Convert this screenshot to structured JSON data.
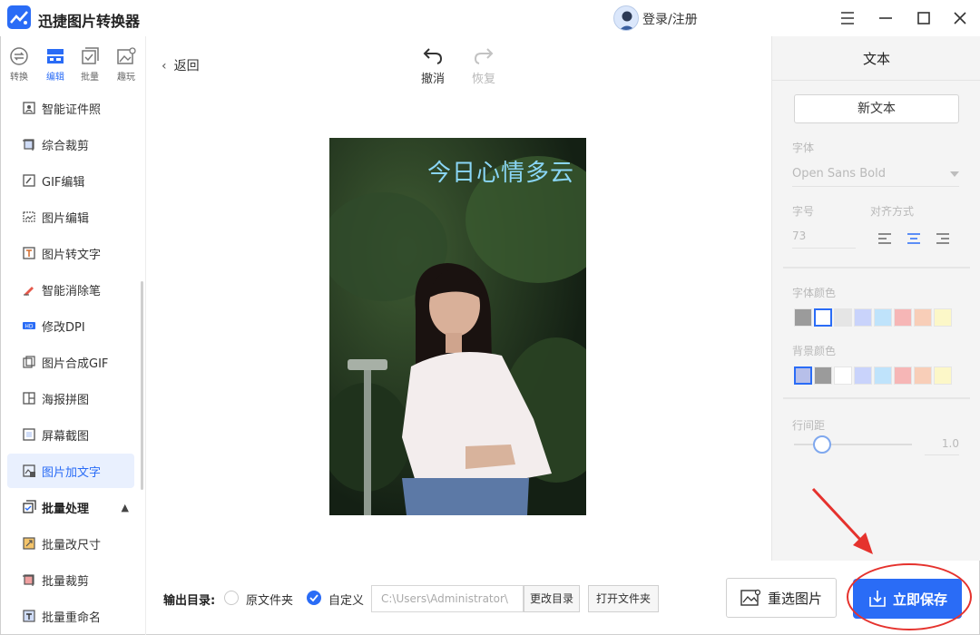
{
  "app": {
    "title": "迅捷图片转换器",
    "login": "登录/注册"
  },
  "tool_tabs": [
    {
      "label": "转换"
    },
    {
      "label": "编辑"
    },
    {
      "label": "批量"
    },
    {
      "label": "趣玩"
    }
  ],
  "sidebar": {
    "items": [
      {
        "label": "智能证件照"
      },
      {
        "label": "综合裁剪"
      },
      {
        "label": "GIF编辑"
      },
      {
        "label": "图片编辑"
      },
      {
        "label": "图片转文字"
      },
      {
        "label": "智能消除笔"
      },
      {
        "label": "修改DPI"
      },
      {
        "label": "图片合成GIF"
      },
      {
        "label": "海报拼图"
      },
      {
        "label": "屏幕截图"
      },
      {
        "label": "图片加文字"
      }
    ],
    "group": {
      "label": "批量处理"
    },
    "group_items": [
      {
        "label": "批量改尺寸"
      },
      {
        "label": "批量裁剪"
      },
      {
        "label": "批量重命名"
      }
    ]
  },
  "center": {
    "back": "返回",
    "undo": "撤消",
    "redo": "恢复",
    "overlay_text": "今日心情多云"
  },
  "panel": {
    "title": "文本",
    "new_text": "新文本",
    "font_label": "字体",
    "font_value": "Open Sans Bold",
    "size_label": "字号",
    "size_value": "73",
    "align_label": "对齐方式",
    "font_color_label": "字体颜色",
    "bg_color_label": "背景颜色",
    "line_spacing_label": "行间距",
    "line_spacing_value": "1.0",
    "font_colors": [
      "#9b9b9b",
      "#ffffff",
      "#e5e5e5",
      "#c9d3fb",
      "#bfe3fb",
      "#f6b6b6",
      "#f8ceb8",
      "#fcf7c8"
    ],
    "bg_colors": [
      "#b7bfe9",
      "#9b9b9b",
      "#ffffff",
      "#c9d3fb",
      "#bfe3fb",
      "#f6b6b6",
      "#f8ceb8",
      "#fcf7c8"
    ]
  },
  "bottom": {
    "output_label": "输出目录:",
    "radio_original": "原文件夹",
    "radio_custom": "自定义",
    "path": "C:\\Users\\Administrator\\",
    "change_dir": "更改目录",
    "open_folder": "打开文件夹",
    "reselect": "重选图片",
    "save": "立即保存"
  },
  "colors": {
    "accent": "#2a6cf6",
    "annotation": "#e5322d"
  }
}
